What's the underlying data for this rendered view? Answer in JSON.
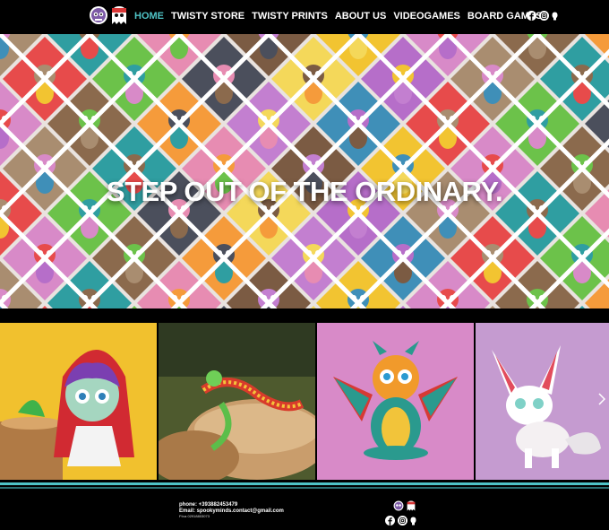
{
  "header": {
    "logos": [
      "skull-doll-logo",
      "ghost-skull-logo"
    ],
    "nav": [
      {
        "label": "HOME",
        "active": true
      },
      {
        "label": "TWISTY STORE",
        "active": false
      },
      {
        "label": "TWISTY PRINTS",
        "active": false
      },
      {
        "label": "ABOUT US",
        "active": false
      },
      {
        "label": "VIDEOGAMES",
        "active": false
      },
      {
        "label": "BOARD GAMES",
        "active": false
      }
    ],
    "social_icons": [
      "facebook-icon",
      "instagram-icon",
      "tiktok-icon"
    ]
  },
  "hero": {
    "title": "STEP OUT OF THE ORDINARY."
  },
  "gallery": {
    "items": [
      {
        "subject": "red-riding-hood-figure",
        "bg": "#f2c230"
      },
      {
        "subject": "articulated-dragon-figure",
        "bg": "#6b5037"
      },
      {
        "subject": "winged-dragon-figure",
        "bg": "#d887c8"
      },
      {
        "subject": "white-fox-figure",
        "bg": "#c99bd0"
      }
    ],
    "next_icon": "chevron-right-icon"
  },
  "footer": {
    "phone": "phone: +393882453479",
    "email": "Email: spookyminds.contact@gmail.com",
    "vat": "P.iva 02918803073",
    "logos": [
      "skull-doll-logo",
      "ghost-skull-logo"
    ],
    "social_icons": [
      "facebook-icon",
      "instagram-icon",
      "tiktok-icon"
    ]
  },
  "colors": {
    "accent": "#4fc3c6",
    "background": "#000000",
    "text": "#ffffff"
  }
}
